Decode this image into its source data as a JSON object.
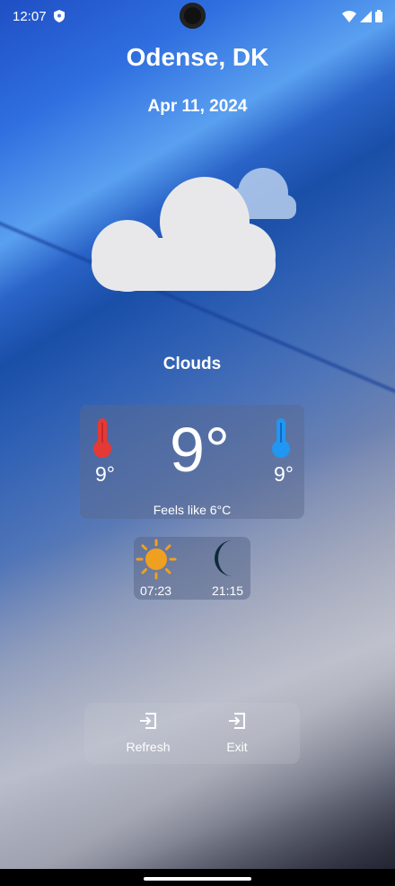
{
  "status": {
    "time": "12:07"
  },
  "location": {
    "city": "Odense, DK",
    "date": "Apr 11, 2024"
  },
  "weather": {
    "condition": "Clouds",
    "temp_current": "9°",
    "temp_min": "9°",
    "temp_max": "9°",
    "feels_like": "Feels like 6°C",
    "sunrise": "07:23",
    "sunset": "21:15"
  },
  "buttons": {
    "refresh": "Refresh",
    "exit": "Exit"
  },
  "colors": {
    "min_thermometer": "#e53935",
    "max_thermometer": "#2196f3",
    "sun": "#f0a020",
    "moon": "#0f2a3a"
  }
}
